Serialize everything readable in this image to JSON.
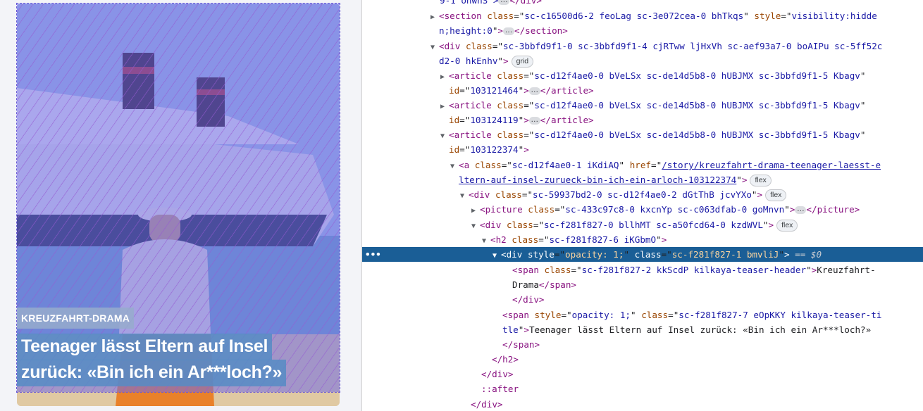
{
  "page_preview": {
    "teaser_header": "KREUZFAHRT-DRAMA",
    "teaser_title": "Teenager lässt Eltern auf Insel zurück: «Bin ich ein Ar***loch?»"
  },
  "devtools": {
    "line_top_partial": "9-1 onwnS\">",
    "section_tag": "section",
    "section_class": "sc-c16500d6-2 feoLag sc-3e072cea-0 bhTkqs",
    "section_style_1": "visibility:hidde",
    "section_style_2": "n;height:0",
    "grid_div_class_1": "sc-3bbfd9f1-0 sc-3bbfd9f1-4 cjRTww ljHxVh sc-aef93a7-0 boAIPu sc-5ff52c",
    "grid_div_class_2": "d2-0 hkEnhv",
    "badge_grid": "grid",
    "article_class": "sc-d12f4ae0-0 bVeLSx sc-de14d5b8-0 hUBJMX sc-3bbfd9f1-5 Kbagv",
    "article_1_id": "103121464",
    "article_2_id": "103124119",
    "article_3_id": "103122374",
    "a_class": "sc-d12f4ae0-1 iKdiAQ",
    "a_href_1": "/story/kreuzfahrt-drama-teenager-laesst-e",
    "a_href_2": "ltern-auf-insel-zurueck-bin-ich-ein-arloch-103122374",
    "badge_flex": "flex",
    "div_flex_class": "sc-59937bd2-0 sc-d12f4ae0-2 dGtThB jcvYXo",
    "picture_class": "sc-433c97c8-0 kxcnYp sc-c063dfab-0 goMnvn",
    "div_inner_class": "sc-f281f827-0 bllhMT sc-a50fcd64-0 kzdWVL",
    "h2_class": "sc-f281f827-6 iKGbmO",
    "selected_div_style": "opacity: 1;",
    "selected_div_class": "sc-f281f827-1 bmvliJ",
    "selected_suffix": "== $0",
    "span_header_class": "sc-f281f827-2 kkScdP kilkaya-teaser-header",
    "span_header_text_1": "Kreuzfahrt-",
    "span_header_text_2": "Drama",
    "span_title_style": "opacity: 1;",
    "span_title_class_1": "sc-f281f827-7 eOpKKY kilkaya-teaser-ti",
    "span_title_class_2": "tle",
    "span_title_text": "Teenager lässt Eltern auf Insel zurück: «Bin ich ein Ar***loch?»",
    "pseudo_after": "::after",
    "gutter_dots": "•••"
  }
}
